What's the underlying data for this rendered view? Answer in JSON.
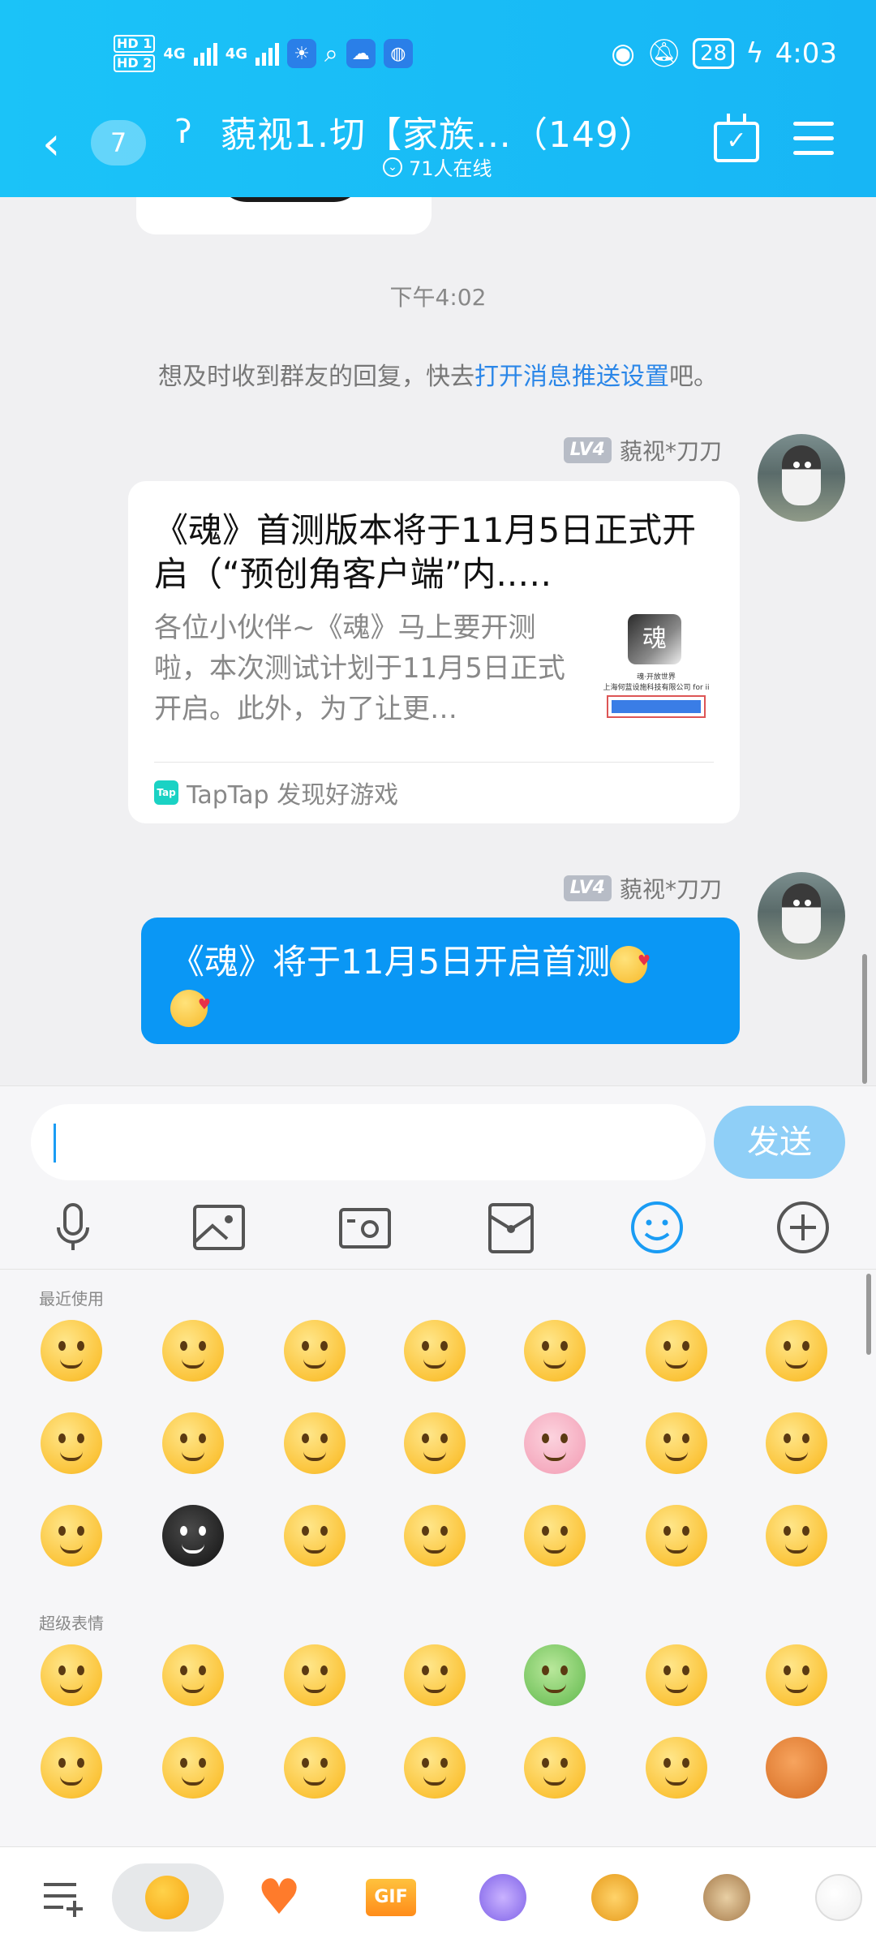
{
  "status_bar": {
    "hd1": "HD 1",
    "hd2": "HD 2",
    "net1": "4G",
    "net2": "4G",
    "battery": "28",
    "time": "4:03"
  },
  "header": {
    "unread_count": "7",
    "title": "藐视1.切【家族…（149）",
    "online": "71人在线"
  },
  "chat": {
    "timestamp": "下午4:02",
    "tip_prefix": "想及时收到群友的回复，快去",
    "tip_link": "打开消息推送设置",
    "tip_suffix": "吧。",
    "messages": [
      {
        "level": "LV4",
        "sender": "藐视*刀刀",
        "card": {
          "title": "《魂》首测版本将于11月5日正式开启（“预创角客户端”内..…",
          "desc": "各位小伙伴~《魂》马上要开测啦，本次测试计划于11月5日正式开启。此外，为了让更…",
          "thumb_icon_text": "魂",
          "thumb_line1": "魂·开放世界",
          "thumb_line2": "上海何蓝设施科技有限公司 for ii",
          "source_icon": "Tap",
          "source": "TapTap 发现好游戏"
        }
      },
      {
        "level": "LV4",
        "sender": "藐视*刀刀",
        "text": "《魂》将于11月5日开启首测"
      }
    ]
  },
  "input": {
    "value": "",
    "send_label": "发送",
    "tools": [
      "microphone-icon",
      "image-icon",
      "camera-icon",
      "red-packet-icon",
      "emoji-icon",
      "plus-icon"
    ]
  },
  "emoji_panel": {
    "recent_label": "最近使用",
    "super_label": "超级表情",
    "recent_emojis": [
      "sweat-face",
      "grin-face",
      "teary-face",
      "kiss-face",
      "laugh-tears-face",
      "smile-face",
      "confused-face",
      "shy-face",
      "sly-face",
      "fear-face",
      "shocked-face",
      "pig-face",
      "laugh-tears-face",
      "penguin-face",
      "pleading-face",
      "black-bug-face",
      "blush-face",
      "laugh-tears-face",
      "thinking-face",
      "smirk-face",
      "question-face"
    ],
    "super_emojis": [
      "cry-face",
      "laugh-face",
      "doubt-face",
      "cool-face",
      "frog-face",
      "love-face",
      "hug-face",
      "party-face",
      "lollipop-face",
      "scream-face",
      "rainbow-face",
      "pray-face",
      "kiss-heart-face",
      "basketball"
    ]
  },
  "bottom_tabs": [
    "emoji-manage-icon",
    "classic-emoji-tab",
    "favorites-heart-tab",
    "gif-tab",
    "character-tab",
    "tiger-tab",
    "dog-tab",
    "heart-sticker-tab"
  ],
  "colors": {
    "header": "#17b6f5",
    "bubble": "#0a97f5",
    "link": "#2a86e8",
    "send_disabled": "#8fcff7"
  }
}
